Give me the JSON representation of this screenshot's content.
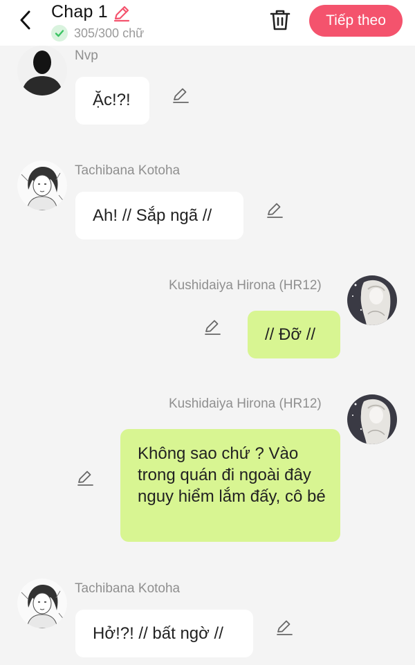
{
  "header": {
    "chapter_title": "Chap 1",
    "word_count": "305/300 chữ",
    "next_button": "Tiếp theo"
  },
  "messages": [
    {
      "sender": "Nvp",
      "text": "Ặc!?!",
      "side": "left"
    },
    {
      "sender": "Tachibana Kotoha",
      "text": "Ah! // Sắp ngã //",
      "side": "left"
    },
    {
      "sender": "Kushidaiya Hirona (HR12)",
      "text": "// Đỡ //",
      "side": "right"
    },
    {
      "sender": "Kushidaiya Hirona (HR12)",
      "text": "Không sao chứ ? Vào trong quán đi ngoài đây nguy hiểm lắm đấy, cô bé",
      "side": "right"
    },
    {
      "sender": "Tachibana Kotoha",
      "text": "Hở!?! // bất ngờ //",
      "side": "left"
    }
  ],
  "icons": {
    "back": "chevron-left-icon",
    "title_edit": "pencil-icon",
    "status": "check-circle-icon",
    "delete": "trash-icon",
    "message_edit": "pencil-icon"
  },
  "colors": {
    "accent": "#f4536d",
    "right_bubble": "#d8f592",
    "left_bubble": "#ffffff",
    "background": "#f4f4f4",
    "check_green": "#3cc463"
  }
}
